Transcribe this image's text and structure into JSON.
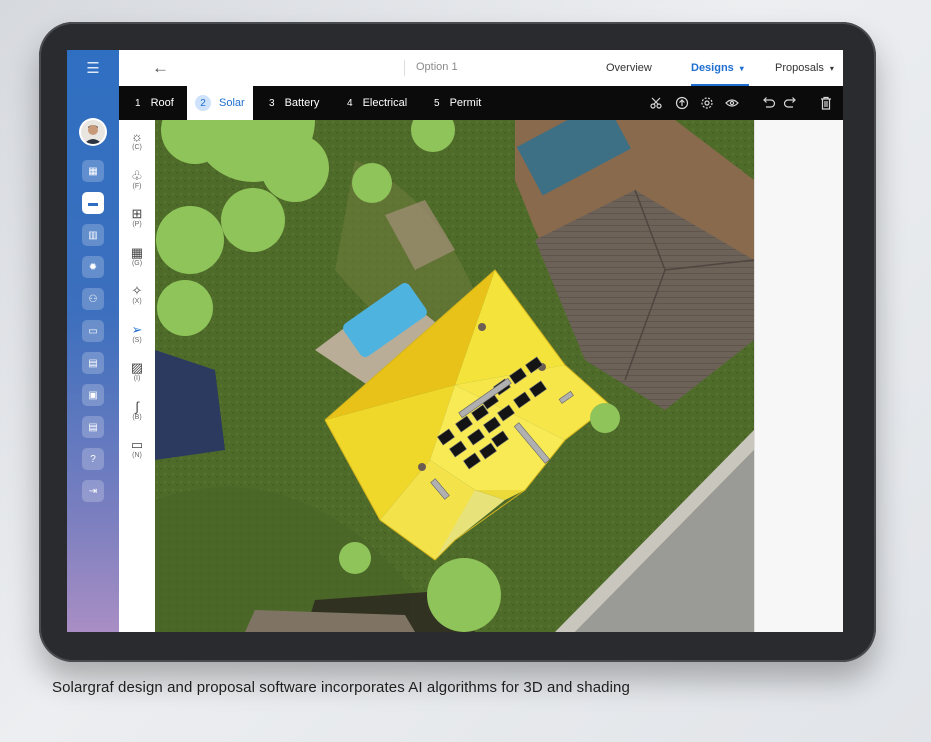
{
  "app": {
    "top_nav": {
      "back_label": "←",
      "option_label": "Option 1",
      "tabs": [
        {
          "label": "Overview",
          "active": false
        },
        {
          "label": "Designs",
          "active": true
        },
        {
          "label": "Proposals",
          "active": false
        }
      ],
      "dropdown_caret": "▾"
    },
    "steps": [
      {
        "num": "1",
        "label": "Roof"
      },
      {
        "num": "2",
        "label": "Solar",
        "active": true
      },
      {
        "num": "3",
        "label": "Battery"
      },
      {
        "num": "4",
        "label": "Electrical"
      },
      {
        "num": "5",
        "label": "Permit"
      }
    ],
    "toolbar_icons": [
      "scissors-icon",
      "upload-icon",
      "settings-icon",
      "eye-icon",
      "undo-icon",
      "redo-icon",
      "trash-icon"
    ],
    "tools": [
      {
        "key": "(C)",
        "icon": "sun-icon",
        "glyph": "☼"
      },
      {
        "key": "(F)",
        "icon": "tree-icon",
        "glyph": "♧"
      },
      {
        "key": "(P)",
        "icon": "panel-array-icon",
        "glyph": "⊞"
      },
      {
        "key": "(G)",
        "icon": "solar-panel-icon",
        "glyph": "▦"
      },
      {
        "key": "(X)",
        "icon": "magic-wand-icon",
        "glyph": "✧"
      },
      {
        "key": "(S)",
        "icon": "select-cursor-icon",
        "glyph": "➢",
        "selected": true
      },
      {
        "key": "(I)",
        "icon": "image-icon",
        "glyph": "▨"
      },
      {
        "key": "(B)",
        "icon": "path-icon",
        "glyph": "∫"
      },
      {
        "key": "(N)",
        "icon": "ruler-icon",
        "glyph": "▭"
      }
    ],
    "sidebar_items": [
      {
        "icon": "dashboard-icon",
        "glyph": "▦"
      },
      {
        "icon": "projects-icon",
        "glyph": "▬",
        "active": true
      },
      {
        "icon": "analytics-icon",
        "glyph": "▥"
      },
      {
        "icon": "settings-icon",
        "glyph": "✹"
      },
      {
        "icon": "team-icon",
        "glyph": "⚇"
      },
      {
        "icon": "display-icon",
        "glyph": "▭"
      },
      {
        "icon": "document-icon",
        "glyph": "▤"
      },
      {
        "icon": "briefcase-icon",
        "glyph": "▣"
      },
      {
        "icon": "file-icon",
        "glyph": "▤"
      },
      {
        "icon": "help-icon",
        "glyph": "?"
      },
      {
        "icon": "logout-icon",
        "glyph": "⇥"
      }
    ]
  },
  "caption": "Solargraf design and proposal software incorporates AI algorithms for 3D and shading",
  "colors": {
    "sidebar_top": "#2f6fc2",
    "sidebar_bottom": "#a98ec4",
    "accent": "#1f6fd1",
    "roof_yellow": "#f2df2a",
    "tree_green": "#8fc45a"
  }
}
